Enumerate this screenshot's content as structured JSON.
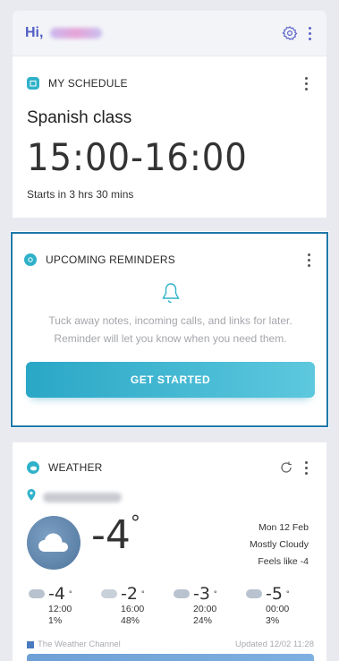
{
  "header": {
    "greeting": "Hi,",
    "settings_icon": "gear-icon",
    "more_icon": "kebab-icon"
  },
  "schedule": {
    "label": "MY SCHEDULE",
    "event_name": "Spanish class",
    "time_range": "15:00-16:00",
    "starts_in": "Starts in 3 hrs 30 mins"
  },
  "reminders": {
    "label": "UPCOMING REMINDERS",
    "description_line1": "Tuck away notes, incoming calls, and links for later.",
    "description_line2": "Reminder will let you know when you need them.",
    "cta": "GET STARTED"
  },
  "weather": {
    "label": "WEATHER",
    "current_temp": "-4",
    "degree": "°",
    "date": "Mon 12 Feb",
    "condition": "Mostly Cloudy",
    "feels_like": "Feels like -4",
    "forecast": [
      {
        "temp": "-4",
        "time": "12:00",
        "precip": "1%"
      },
      {
        "temp": "-2",
        "time": "16:00",
        "precip": "48%"
      },
      {
        "temp": "-3",
        "time": "20:00",
        "precip": "24%"
      },
      {
        "temp": "-5",
        "time": "00:00",
        "precip": "3%"
      }
    ],
    "source": "The Weather Channel",
    "updated": "Updated 12/02 11:28"
  },
  "colors": {
    "accent": "#5360c5",
    "card_icon": "#2fb2c9",
    "button": "#2aa7c6"
  }
}
